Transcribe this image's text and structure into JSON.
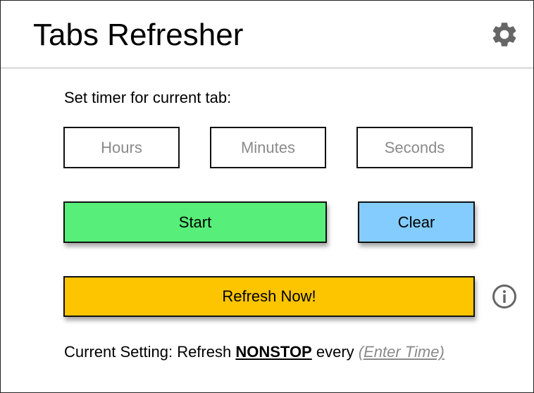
{
  "header": {
    "title": "Tabs Refresher",
    "settings_icon": "gear-icon"
  },
  "timer": {
    "label": "Set timer for current tab:",
    "hours": {
      "value": "",
      "placeholder": "Hours"
    },
    "minutes": {
      "value": "",
      "placeholder": "Minutes"
    },
    "seconds": {
      "value": "",
      "placeholder": "Seconds"
    }
  },
  "buttons": {
    "start": "Start",
    "clear": "Clear",
    "refresh_now": "Refresh Now!"
  },
  "info_icon": "info-icon",
  "status": {
    "prefix": "Current Setting: Refresh ",
    "mode": "NONSTOP",
    "middle": " every ",
    "enter_time": "(Enter Time)"
  },
  "colors": {
    "start": "#57ee79",
    "clear": "#84ccfd",
    "refresh": "#fcc500",
    "placeholder": "#8a8a8a",
    "icon": "#666666"
  }
}
